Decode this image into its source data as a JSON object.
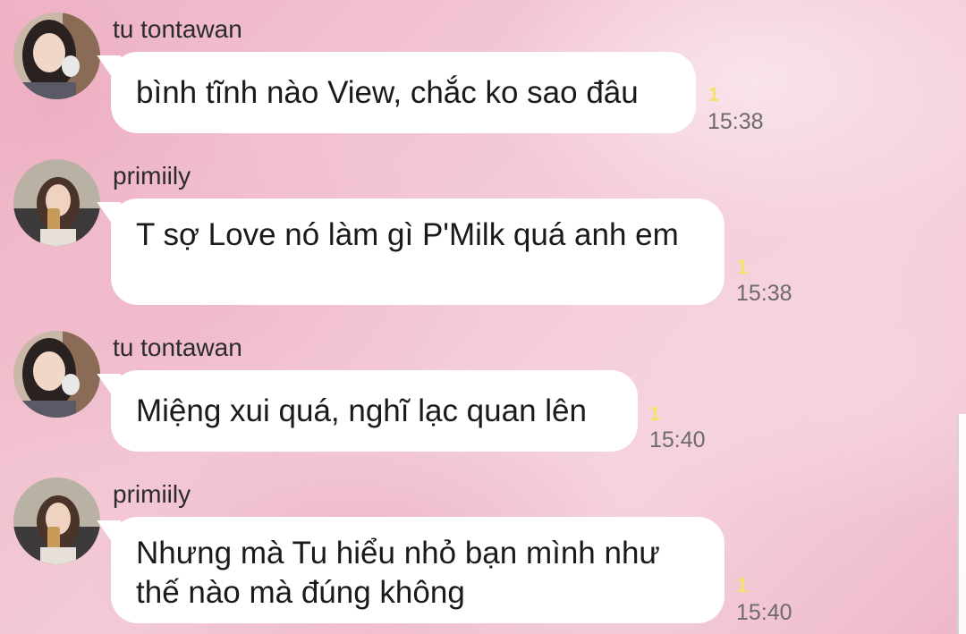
{
  "chat": {
    "messages": [
      {
        "sender": "tu tontawan",
        "text": "bình tĩnh nào View, chắc ko sao đâu",
        "read": "1",
        "time": "15:38"
      },
      {
        "sender": "primiily",
        "text": "T sợ Love nó làm gì P'Milk quá anh em",
        "read": "1",
        "time": "15:38"
      },
      {
        "sender": "tu tontawan",
        "text": "Miệng xui quá, nghĩ lạc quan lên",
        "read": "1",
        "time": "15:40"
      },
      {
        "sender": "primiily",
        "text": "Nhưng mà Tu hiểu nhỏ bạn mình như thế nào mà đúng không",
        "read": "1",
        "time": "15:40"
      }
    ]
  },
  "colors": {
    "bubble": "#ffffff",
    "read_indicator": "#f3e36a",
    "timestamp": "#6e6a6c",
    "background": "#f3c8d5"
  },
  "icons": {
    "avatar_tu": "avatar-tu-tontawan-icon",
    "avatar_primiily": "avatar-primiily-icon"
  }
}
